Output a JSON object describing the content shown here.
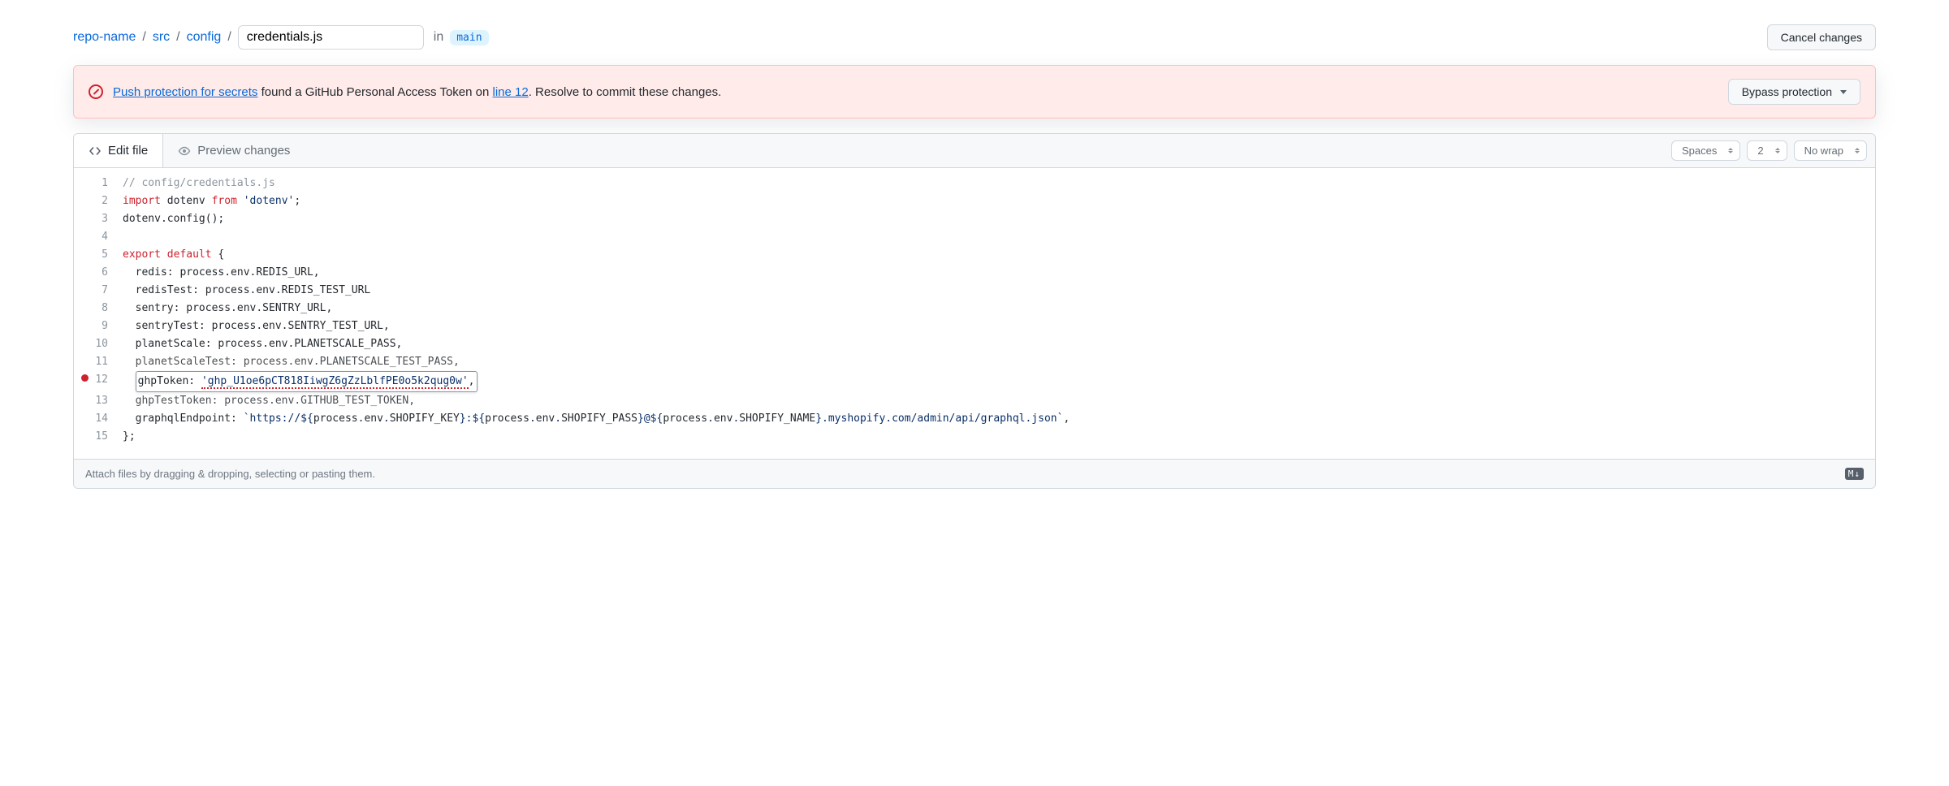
{
  "breadcrumb": {
    "repo": "repo-name",
    "path": [
      "src",
      "config"
    ],
    "file": "credentials.js",
    "in_text": "in",
    "branch": "main"
  },
  "cancel_button": "Cancel changes",
  "alert": {
    "link_protection": "Push protection for secrets",
    "text_mid": " found a GitHub Personal Access Token on ",
    "link_line": "line 12",
    "text_end": ". Resolve to commit these changes.",
    "bypass_button": "Bypass protection"
  },
  "tabs": {
    "edit": "Edit file",
    "preview": "Preview changes"
  },
  "editor_settings": {
    "indent": "Spaces",
    "indent_size": "2",
    "wrap": "No wrap"
  },
  "code": {
    "highlight_line": 12,
    "lines": [
      {
        "n": 1,
        "html": "<span class='tok-comment'>// config/credentials.js</span>"
      },
      {
        "n": 2,
        "html": "<span class='tok-keyword'>import</span> dotenv <span class='tok-keyword'>from</span> <span class='tok-string'>'dotenv'</span>;"
      },
      {
        "n": 3,
        "html": "dotenv.config();"
      },
      {
        "n": 4,
        "html": ""
      },
      {
        "n": 5,
        "html": "<span class='tok-keyword'>export</span> <span class='tok-keyword'>default</span> {"
      },
      {
        "n": 6,
        "html": "  redis: process.env.REDIS_URL,"
      },
      {
        "n": 7,
        "html": "  redisTest: process.env.REDIS_TEST_URL"
      },
      {
        "n": 8,
        "html": "  sentry: process.env.SENTRY_URL,"
      },
      {
        "n": 9,
        "html": "  sentryTest: process.env.SENTRY_TEST_URL,"
      },
      {
        "n": 10,
        "html": "  planetScale: process.env.PLANETSCALE_PASS,"
      },
      {
        "n": 11,
        "html": "  planetScaleTest: process.env.PLANETSCALE_TEST_PASS,",
        "faded": true
      },
      {
        "n": 12,
        "html": "  <span class='hl-box'>ghpToken: <span class='tok-string hl-underline'>'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'</span>,</span>"
      },
      {
        "n": 13,
        "html": "  ghpTestToken: process.env.GITHUB_TEST_TOKEN,",
        "faded": true
      },
      {
        "n": 14,
        "html": "  graphqlEndpoint: <span class='tok-string'>`https://${</span>process<span class='tok-string'>.</span>env<span class='tok-string'>.</span>SHOPIFY_KEY<span class='tok-string'>}:${</span>process<span class='tok-string'>.</span>env<span class='tok-string'>.</span>SHOPIFY_PASS<span class='tok-string'>}@${</span>process<span class='tok-string'>.</span>env<span class='tok-string'>.</span>SHOPIFY_NAME<span class='tok-string'>}.myshopify.com/admin/api/graphql.json`</span>,"
      },
      {
        "n": 15,
        "html": "};"
      }
    ]
  },
  "drop_hint": "Attach files by dragging & dropping, selecting or pasting them.",
  "md_icon_label": "M↓"
}
